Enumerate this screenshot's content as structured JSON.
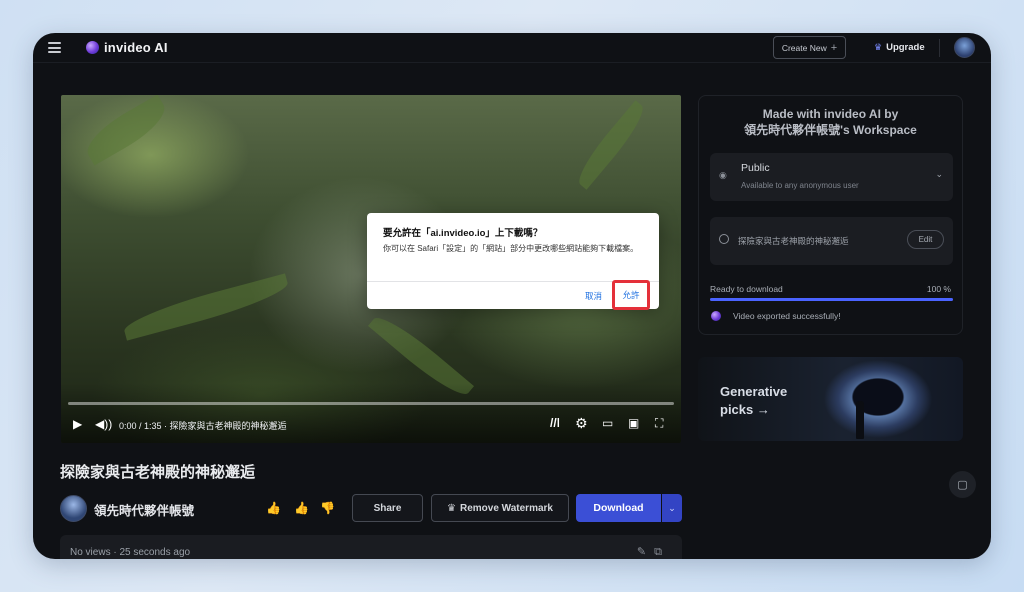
{
  "app": {
    "brand": "invideo AI"
  },
  "topbar": {
    "create_new": "Create New",
    "upgrade": "Upgrade"
  },
  "video": {
    "time": "0:00 / 1:35 · 探險家與古老神殿的神秘邂逅",
    "progress": 0
  },
  "dialog": {
    "title": "要允許在「ai.invideo.io」上下載嗎？",
    "message": "你可以在 Safari「設定」的「網站」部分中更改哪些網站能夠下載檔案。",
    "cancel": "取消",
    "allow": "允許"
  },
  "content": {
    "title": "探險家與古老神殿的神秘邂逅",
    "channel": "領先時代夥伴帳號",
    "share": "Share",
    "remove_watermark": "Remove Watermark",
    "download": "Download",
    "stats": "No views · 25 seconds ago"
  },
  "panel": {
    "title_line1": "Made with invideo AI by",
    "title_line2": "領先時代夥伴帳號's Workspace",
    "visibility": "Public",
    "visibility_sub": "Available to any anonymous user",
    "history_title": "探險家與古老神殿的神秘邂逅",
    "edit": "Edit",
    "ready": "Ready to download",
    "percent": "100 %",
    "progress": 1.0,
    "exported": "Video exported successfully!"
  },
  "promo": {
    "line1": "Generative",
    "line2": "picks →"
  },
  "colors": {
    "accent": "#3b4fd6",
    "highlight": "#e4303a",
    "link": "#1d6fe0"
  }
}
